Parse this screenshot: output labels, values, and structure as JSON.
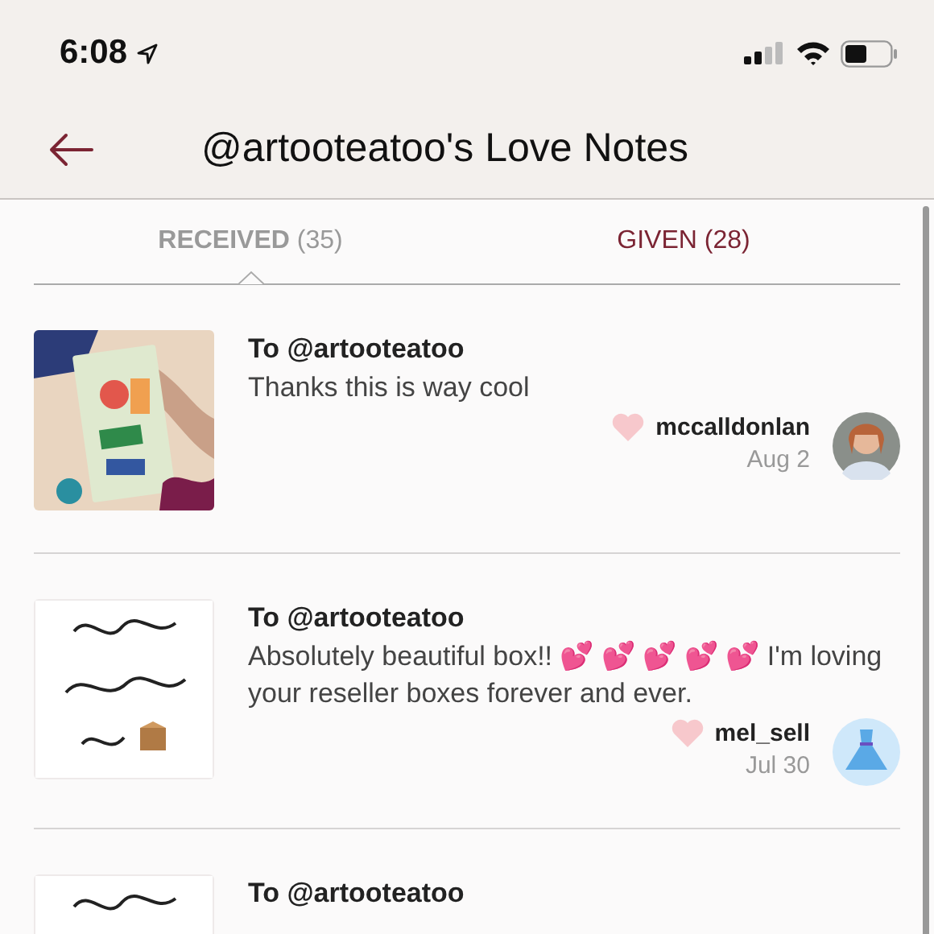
{
  "status_bar": {
    "time": "6:08"
  },
  "header": {
    "title": "@artooteatoo's Love Notes"
  },
  "tabs": [
    {
      "label": "RECEIVED",
      "count": "(35)",
      "selected": true
    },
    {
      "label": "GIVEN",
      "count": "(28)",
      "selected": false
    }
  ],
  "notes": [
    {
      "recipient": "To @artooteatoo",
      "message": "Thanks this is way cool",
      "sender": "mccalldonlan",
      "date": "Aug 2"
    },
    {
      "recipient": "To @artooteatoo",
      "message": "Absolutely beautiful box!! 💕 💕 💕 💕 💕 I'm loving your reseller boxes forever and ever.",
      "sender": "mel_sell",
      "date": "Jul 30"
    },
    {
      "recipient": "To @artooteatoo"
    }
  ]
}
